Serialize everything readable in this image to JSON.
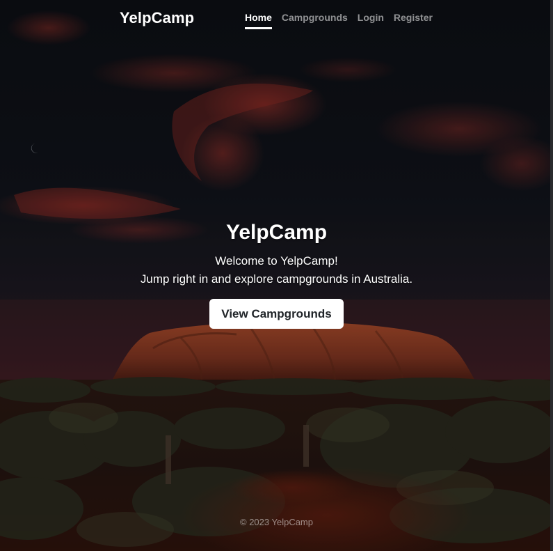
{
  "header": {
    "brand": "YelpCamp",
    "nav": [
      {
        "label": "Home",
        "active": true
      },
      {
        "label": "Campgrounds",
        "active": false
      },
      {
        "label": "Login",
        "active": false
      },
      {
        "label": "Register",
        "active": false
      }
    ]
  },
  "hero": {
    "title": "YelpCamp",
    "line1": "Welcome to YelpCamp!",
    "line2": "Jump right in and explore campgrounds in Australia.",
    "cta_label": "View Campgrounds"
  },
  "footer": {
    "text": "© 2023 YelpCamp"
  },
  "background": {
    "image": "uluru-at-dusk",
    "colors": {
      "sky": "#0c1016",
      "cloud": "#a3302a",
      "rock": "#8a3a22",
      "ground": "#2a1410"
    }
  }
}
